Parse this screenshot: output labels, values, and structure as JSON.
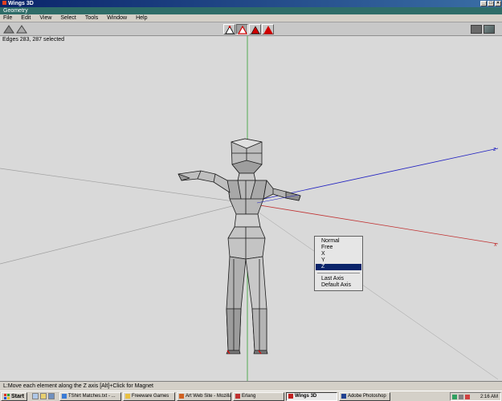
{
  "window": {
    "title": "Wings 3D",
    "controls": [
      "_",
      "□",
      "×"
    ]
  },
  "geometry_bar": {
    "label": "Geometry"
  },
  "menu": [
    "File",
    "Edit",
    "View",
    "Select",
    "Tools",
    "Window",
    "Help"
  ],
  "viewport": {
    "selection_info": "Edges 283, 287 selected"
  },
  "context_menu": {
    "items": [
      "Normal",
      "Free",
      "X",
      "Y",
      "Z"
    ],
    "highlighted": "Z",
    "extra_items": [
      "Last Axis",
      "Default Axis"
    ]
  },
  "status": {
    "text": "L:Move each element along the Z axis  [Alt]+Click for Magnet"
  },
  "taskbar": {
    "start": "Start",
    "tasks": [
      {
        "label": "TShirt Matches.txt - ...",
        "active": false,
        "icon_color": "#3a7bd5"
      },
      {
        "label": "Freeware Games",
        "active": false,
        "icon_color": "#e8c040"
      },
      {
        "label": "Art Web Site - Mozilla",
        "active": false,
        "icon_color": "#d06020"
      },
      {
        "label": "Erlang",
        "active": false,
        "icon_color": "#c03030"
      },
      {
        "label": "Wings 3D",
        "active": true,
        "icon_color": "#c02020"
      },
      {
        "label": "Adobe Photoshop",
        "active": false,
        "icon_color": "#204090"
      }
    ],
    "clock": "2:16 AM"
  },
  "colors": {
    "title_bar": "#0a246a",
    "geometry_bar": "#2f6d68",
    "viewport_bg": "#d9d9d9",
    "axis_x": "#c03030",
    "axis_y": "#30a030",
    "axis_z": "#2020c0",
    "highlight": "#0a246a"
  }
}
